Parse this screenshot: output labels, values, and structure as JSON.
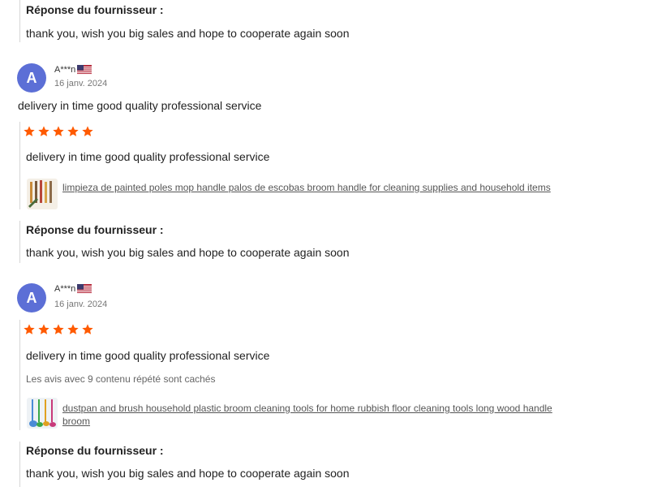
{
  "reply_label": "Réponse du fournisseur :",
  "reply_text": "thank you, wish you big sales and hope to cooperate again soon",
  "colors": {
    "avatar": "#5c6fd6",
    "star": "#ff5a00",
    "reply_border": "#d6d6d6"
  },
  "reviews": [
    {
      "avatar_letter": "A",
      "name": "A***n",
      "flag_icon": "us-flag-icon",
      "date": "16 janv. 2024",
      "text": "delivery in time good quality professional service",
      "rating": 5,
      "product_title": "limpieza de painted poles mop handle palos de escobas broom handle for cleaning supplies and household items"
    },
    {
      "avatar_letter": "A",
      "name": "A***n",
      "flag_icon": "us-flag-icon",
      "date": "16 janv. 2024",
      "rating": 5,
      "text": "delivery in time good quality professional service",
      "hidden_note": "Les avis avec 9 contenu répété sont cachés",
      "product_title": "dustpan and brush household plastic broom cleaning tools for home rubbish floor cleaning tools long wood handle broom"
    }
  ]
}
